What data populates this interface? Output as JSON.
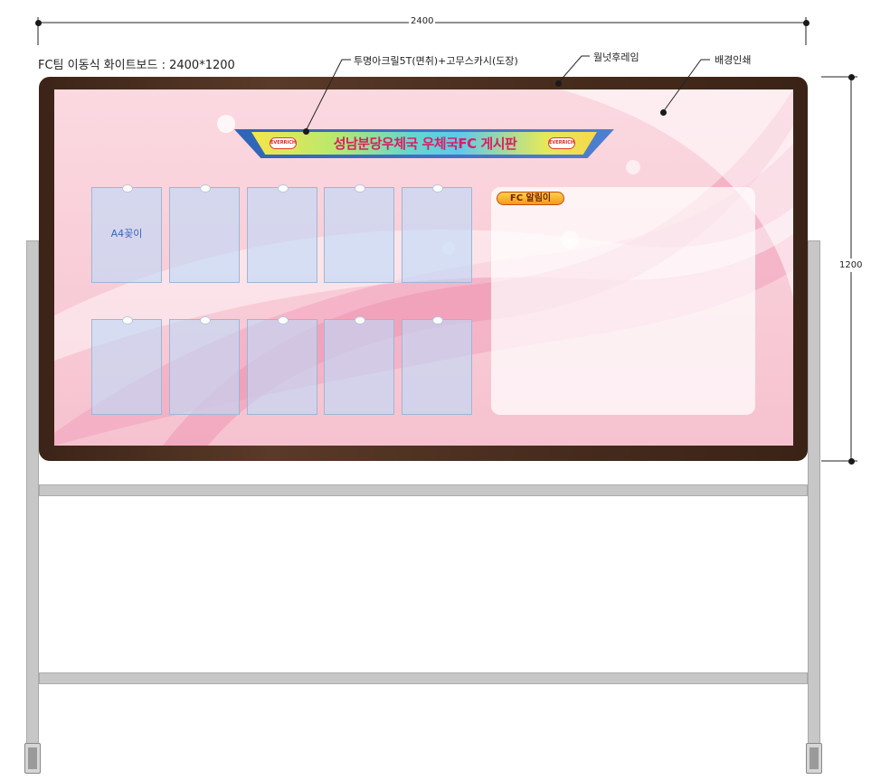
{
  "header": {
    "title": "FC팀 이동식 화이트보드 : 2400*1200"
  },
  "dimensions": {
    "width_label": "2400",
    "height_label": "1200"
  },
  "callouts": {
    "acrylic": "투명아크릴5T(면취)+고무스카시(도장)",
    "frame": "월넛후레임",
    "background": "배경인쇄"
  },
  "board": {
    "banner_title": "성남분당우체국 우체국FC 게시판",
    "logo_text": "EVERRICH",
    "pocket_label": "A4꽂이",
    "notice_label": "FC 알림이",
    "pocket_rows": 2,
    "pocket_cols": 5
  },
  "colors": {
    "frame": "#4a2e1f",
    "background_pink": "#f9cfd9",
    "pocket_blue": "#bedaf8",
    "banner_title": "#d91e63",
    "stand_grey": "#c7c7c7"
  }
}
